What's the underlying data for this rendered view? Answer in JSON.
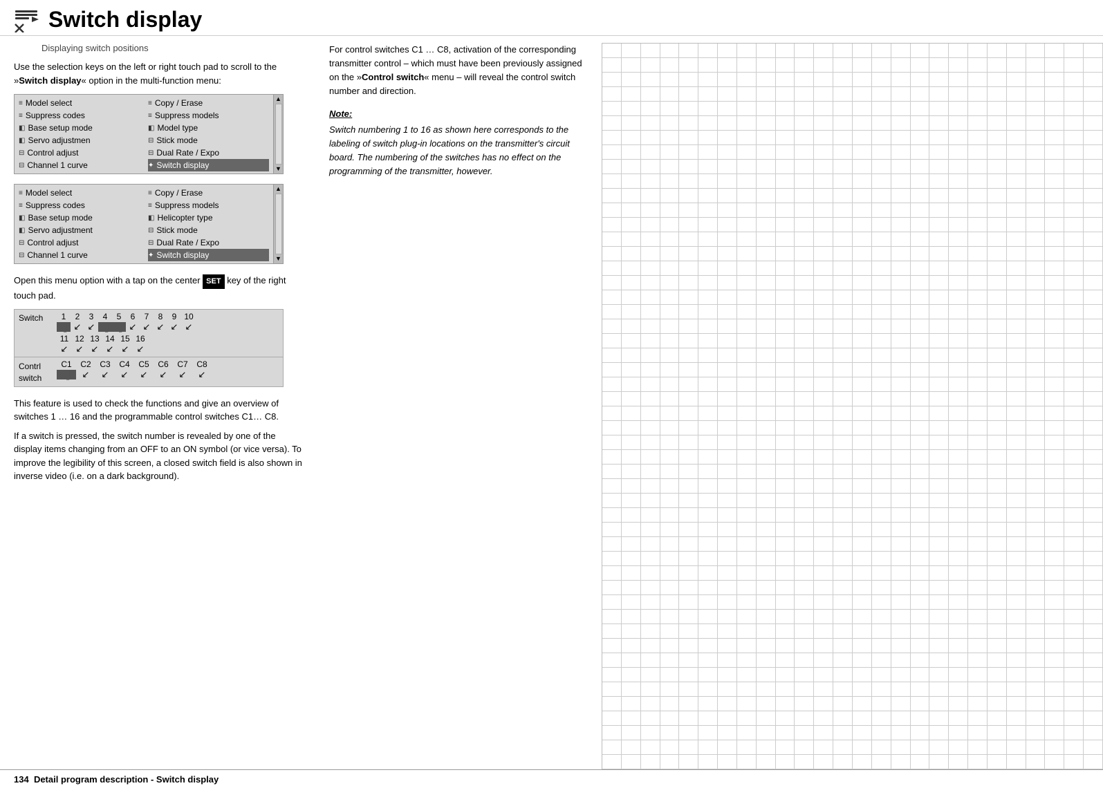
{
  "header": {
    "title": "Switch display",
    "icon_alt": "switch-display-icon"
  },
  "subtitle": "Displaying switch positions",
  "intro": {
    "text_before": "Use the selection keys on the left or right touch pad to scroll to the »",
    "bold_text": "Switch display",
    "text_after": "« option in the multi-function menu:"
  },
  "menu_box_1": {
    "col1": [
      {
        "icon": "≡",
        "label": "Model select"
      },
      {
        "icon": "≡",
        "label": "Suppress codes"
      },
      {
        "icon": "◧",
        "label": "Base setup mode"
      },
      {
        "icon": "◧",
        "label": "Servo adjustmen"
      },
      {
        "icon": "⊟",
        "label": "Control adjust"
      },
      {
        "icon": "⊟",
        "label": "Channel 1 curve"
      }
    ],
    "col2": [
      {
        "icon": "≡",
        "label": "Copy / Erase"
      },
      {
        "icon": "≡",
        "label": "Suppress models"
      },
      {
        "icon": "◧",
        "label": "Model type"
      },
      {
        "icon": "⊟",
        "label": "Stick mode"
      },
      {
        "icon": "⊟",
        "label": "Dual Rate / Expo"
      },
      {
        "icon": "⚡",
        "label": "Switch display",
        "selected": true
      }
    ]
  },
  "menu_box_2": {
    "col1": [
      {
        "icon": "≡",
        "label": "Model select"
      },
      {
        "icon": "≡",
        "label": "Suppress codes"
      },
      {
        "icon": "◧",
        "label": "Base setup mode"
      },
      {
        "icon": "◧",
        "label": "Servo adjustment"
      },
      {
        "icon": "⊟",
        "label": "Control adjust"
      },
      {
        "icon": "⊟",
        "label": "Channel 1 curve"
      }
    ],
    "col2": [
      {
        "icon": "≡",
        "label": "Copy / Erase"
      },
      {
        "icon": "≡",
        "label": "Suppress models"
      },
      {
        "icon": "◧",
        "label": "Helicopter type"
      },
      {
        "icon": "⊟",
        "label": "Stick mode"
      },
      {
        "icon": "⊟",
        "label": "Dual Rate / Expo"
      },
      {
        "icon": "⚡",
        "label": "Switch display",
        "selected": true
      }
    ]
  },
  "open_text_before": "Open this menu option with a tap on the center ",
  "set_label": "SET",
  "open_text_after": " key of the right touch pad.",
  "switch_table": {
    "header_label": "Switch",
    "numbers_row1": [
      "1",
      "2",
      "3",
      "4",
      "5",
      "6",
      "7",
      "8",
      "9",
      "10"
    ],
    "symbols_row1": [
      "▐",
      "ʼ",
      "ʼ",
      "▐",
      "▐",
      "ʼ",
      "ʼ",
      "ʼ",
      "ʼ",
      "ʼ"
    ],
    "numbers_row2": [
      "11",
      "12",
      "13",
      "14",
      "15",
      "16"
    ],
    "symbols_row2": [
      "ʼ",
      "ʼ",
      "ʼ",
      "ʼ",
      "ʼ",
      "ʼ"
    ],
    "contrl_label": "Contrl\nswitch",
    "contrl_nums": [
      "C1",
      "C2",
      "C3",
      "C4",
      "C5",
      "C6",
      "C7",
      "C8"
    ],
    "contrl_syms": [
      "▐",
      "ʼ",
      "ʼ",
      "ʼ",
      "ʼ",
      "ʼ",
      "ʼ",
      "ʼ"
    ]
  },
  "desc_text": [
    "This feature is used to check the functions and give an overview of switches 1 … 16 and the programmable control switches C1… C8.",
    "If a switch is pressed, the switch number is revealed by one of the display items changing from an OFF to an ON symbol (or vice versa). To improve the legibility of this screen, a closed switch field is also shown in inverse video (i.e. on a dark background)."
  ],
  "right_col": {
    "text": "For control switches C1 … C8, activation of the corresponding transmitter control – which must have been previously assigned on the »",
    "bold": "Control switch",
    "text2": "« menu – will reveal the control switch number and direction.",
    "note_label": "Note:",
    "note_text": "Switch numbering 1 to 16 as shown here corresponds to the labeling of switch plug-in locations on the transmitter's circuit board. The numbering of the switches has no effect on the programming of the transmitter, however."
  },
  "footer": {
    "page_num": "134",
    "text": "Detail program description - Switch display"
  }
}
